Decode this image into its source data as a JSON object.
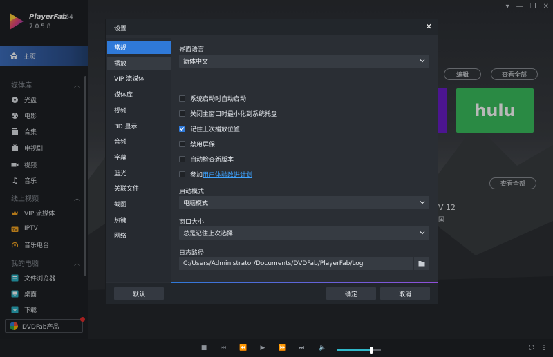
{
  "app": {
    "name": "PlayerFab",
    "arch": "x64",
    "version": "7.0.5.8"
  },
  "window_controls": [
    "▾",
    "—",
    "❐",
    "✕"
  ],
  "sidebar": {
    "home": "主页",
    "sections": [
      {
        "title": "媒体库",
        "items": [
          "光盘",
          "电影",
          "合集",
          "电视剧",
          "视频",
          "音乐"
        ]
      },
      {
        "title": "线上视频",
        "items": [
          "VIP 流媒体",
          "IPTV",
          "音乐电台"
        ]
      },
      {
        "title": "我的电脑",
        "items": [
          "文件浏览器",
          "桌面",
          "下载"
        ]
      }
    ],
    "dvdfab": "DVDFab产品"
  },
  "background": {
    "edit_button": "编辑",
    "view_all_1": "查看全部",
    "view_all_2": "查看全部",
    "hulu": "hulu",
    "partial_title": "V 12",
    "partial_sub": "国"
  },
  "dialog": {
    "title": "设置",
    "close": "✕",
    "nav": [
      "常规",
      "播放",
      "VIP 流媒体",
      "媒体库",
      "视频",
      "3D 显示",
      "音频",
      "字幕",
      "蓝光",
      "关联文件",
      "截图",
      "热键",
      "网络"
    ],
    "active_nav": 0,
    "language_label": "界面语言",
    "language_value": "简体中文",
    "checkboxes": [
      {
        "label": "系统启动时自动启动",
        "checked": false
      },
      {
        "label": "关闭主窗口时最小化到系统托盘",
        "checked": false
      },
      {
        "label": "记住上次播放位置",
        "checked": true
      },
      {
        "label": "禁用屏保",
        "checked": false
      },
      {
        "label": "自动检查新版本",
        "checked": false
      }
    ],
    "join_prefix": "参加",
    "join_link": "用户体验改进计划",
    "startup_label": "启动模式",
    "startup_value": "电脑模式",
    "window_size_label": "窗口大小",
    "window_size_value": "总是记住上次选择",
    "log_label": "日志路径",
    "log_value": "C:/Users/Administrator/Documents/DVDFab/PlayerFab/Log",
    "default_button": "默认",
    "ok_button": "确定",
    "cancel_button": "取消"
  },
  "player": {
    "volume": 0.78
  },
  "colors": {
    "accent": "#2f79d8",
    "link": "#3ea3ff",
    "hulu": "#3bbf5f"
  }
}
